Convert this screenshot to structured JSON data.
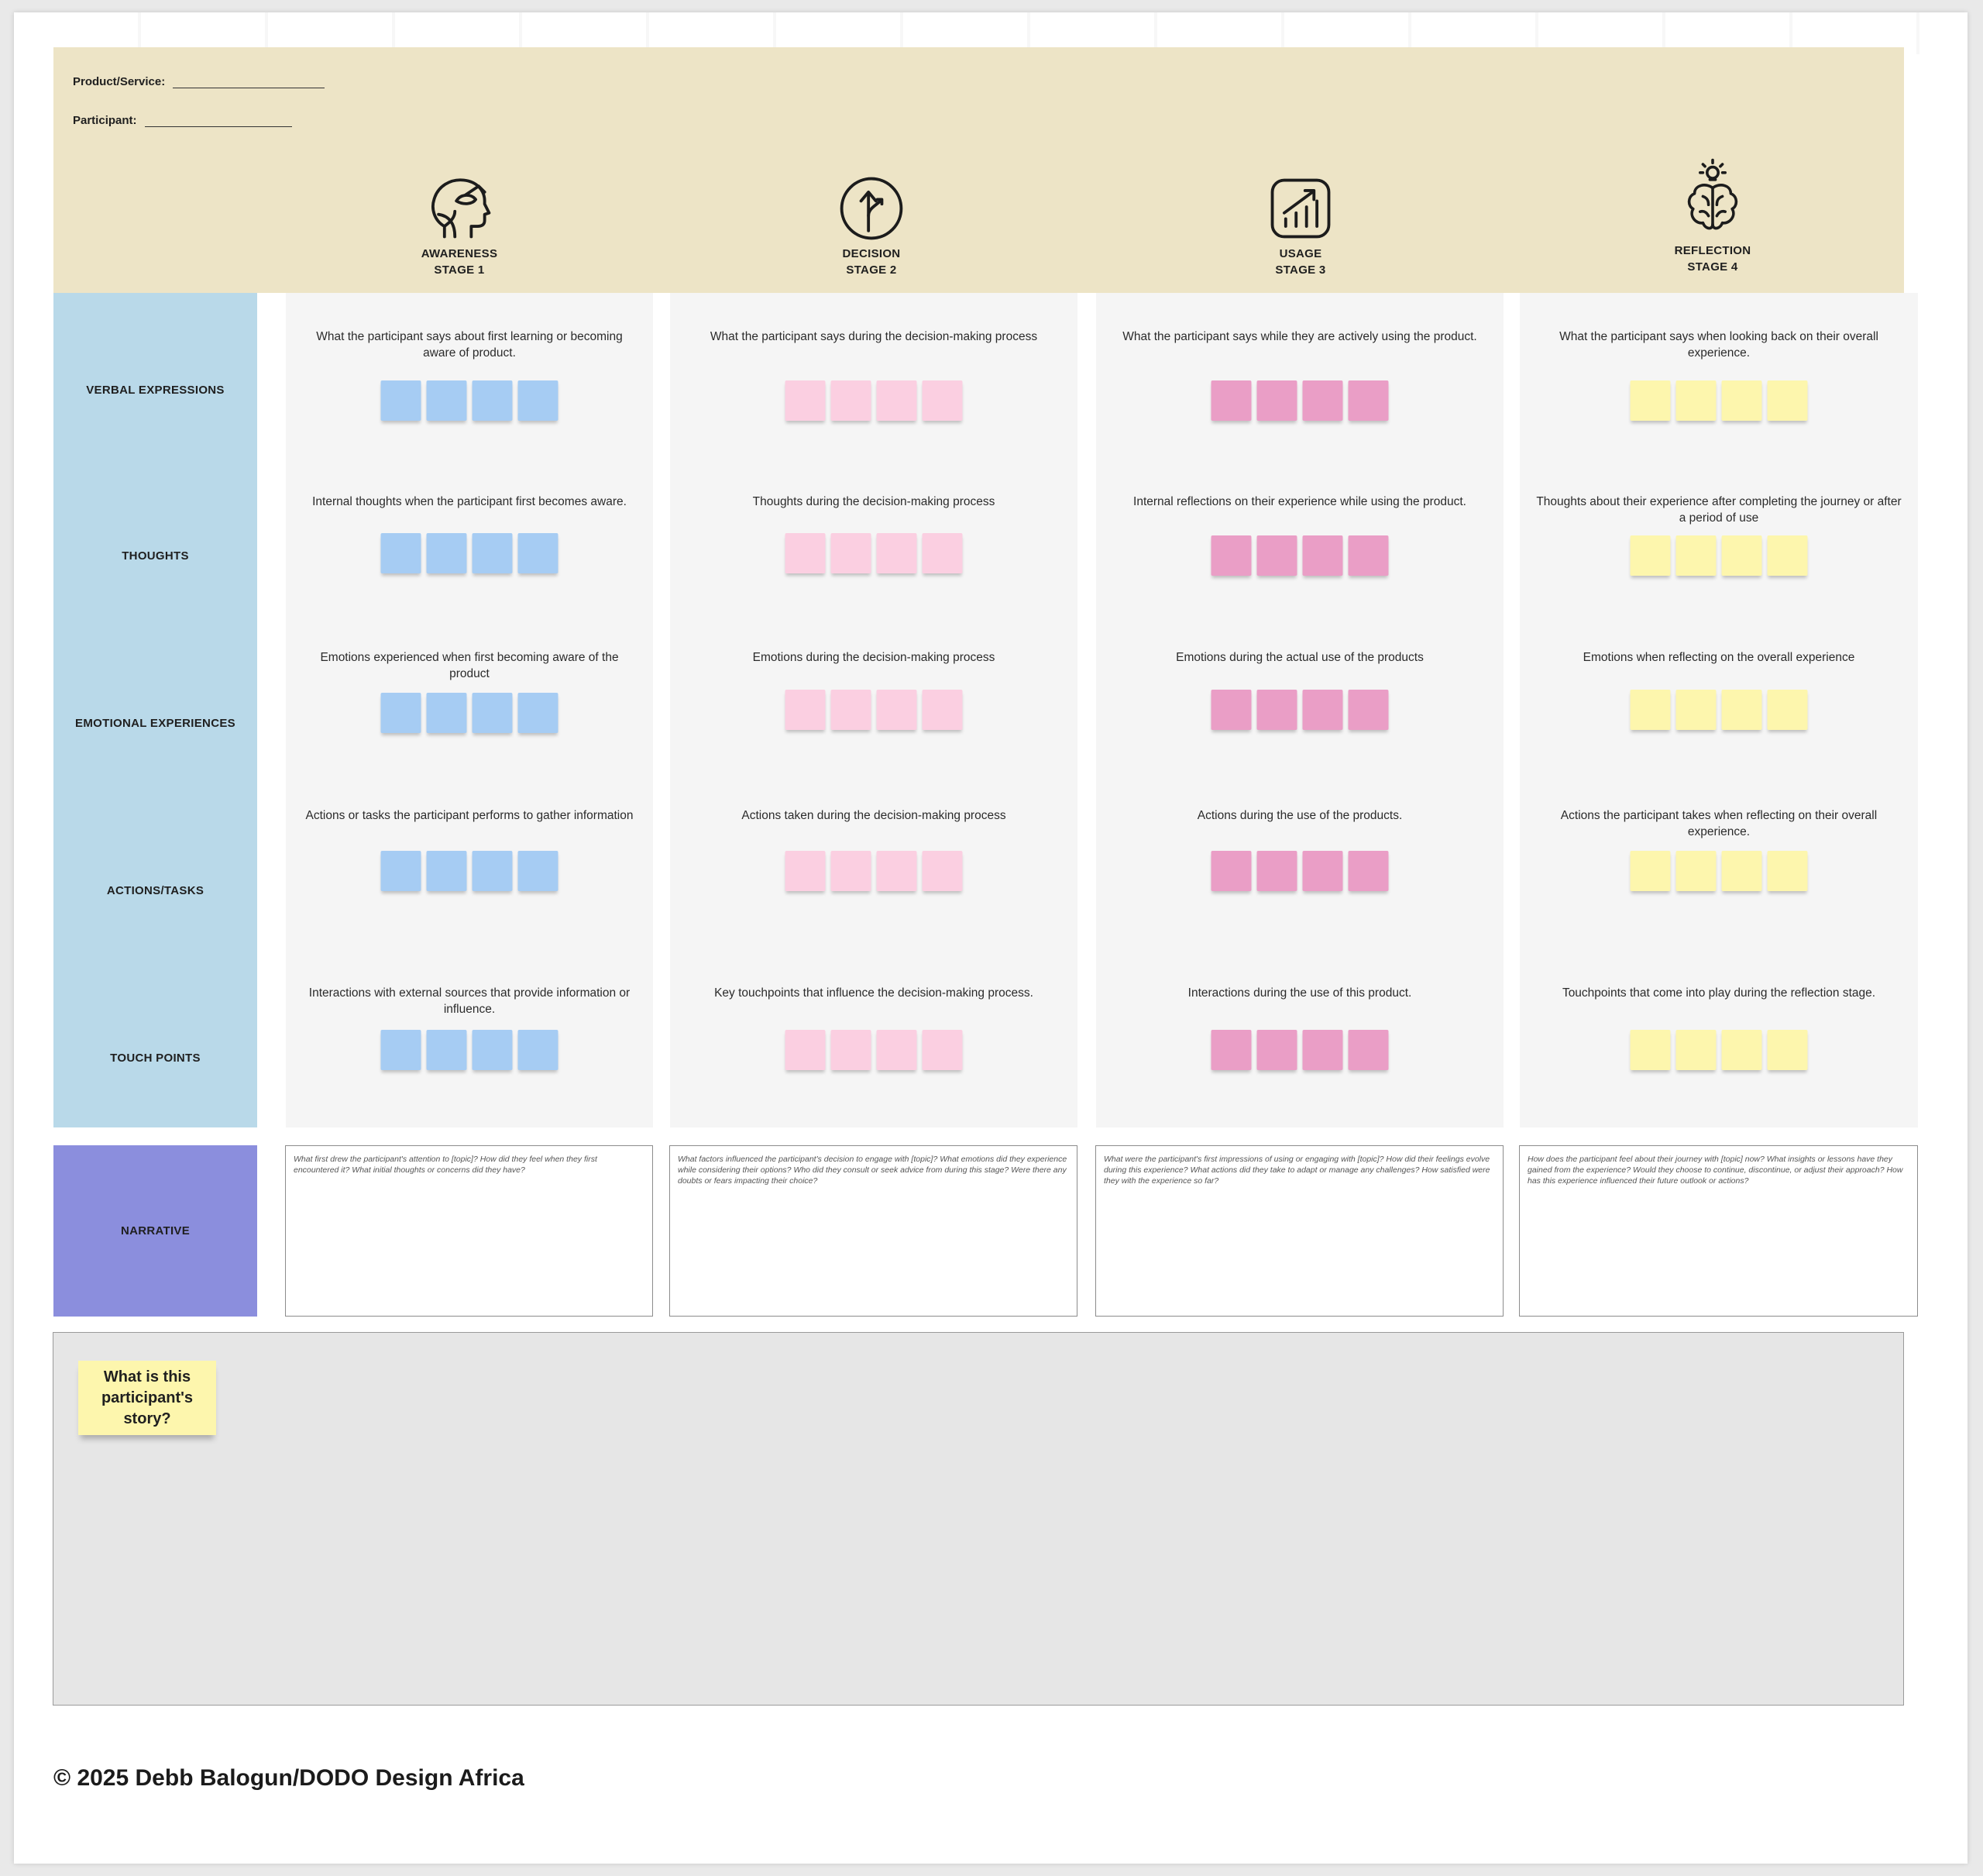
{
  "header": {
    "product_label": "Product/Service:",
    "participant_label": "Participant:"
  },
  "stages": [
    {
      "name": "AWARENESS",
      "num": "STAGE 1",
      "icon": "head-profile-icon"
    },
    {
      "name": "DECISION",
      "num": "STAGE 2",
      "icon": "direction-arrow-icon"
    },
    {
      "name": "USAGE",
      "num": "STAGE 3",
      "icon": "growth-chart-icon"
    },
    {
      "name": "REFLECTION",
      "num": "STAGE 4",
      "icon": "brain-lightbulb-icon"
    }
  ],
  "rows": [
    "VERBAL EXPRESSIONS",
    "THOUGHTS",
    "EMOTIONAL EXPERIENCES",
    "ACTIONS/TASKS",
    "TOUCH POINTS"
  ],
  "cells": [
    [
      "What the participant says about first learning or becoming aware of product.",
      "Internal thoughts when the participant first becomes aware.",
      "Emotions experienced when first becoming aware of the product",
      "Actions or tasks the participant performs to gather information",
      "Interactions with external sources that provide information or influence."
    ],
    [
      "What the participant says during the decision-making process",
      "Thoughts during the decision-making process",
      "Emotions during the decision-making process",
      "Actions taken during the decision-making process",
      "Key touchpoints that influence the decision-making process."
    ],
    [
      "What the participant says while they are actively using the product.",
      "Internal reflections on their experience while using the product.",
      "Emotions during the actual use of the products",
      "Actions during the use of the products.",
      "Interactions during the use of this product."
    ],
    [
      "What the participant says when looking back on their overall experience.",
      "Thoughts about their experience after completing the journey or after a period of use",
      "Emotions when reflecting on the overall experience",
      "Actions the participant takes when reflecting on their overall experience.",
      "Touchpoints that come into play during the reflection stage."
    ]
  ],
  "note_colors": {
    "blue": "#a6ccf3",
    "pink": "#fbcfe1",
    "magenta": "#ea9ec6",
    "yellow": "#fdf6ad"
  },
  "narrative": {
    "label": "NARRATIVE",
    "prompts": [
      "What first drew the participant's attention to [topic]? How did they feel when they first encountered it? What initial thoughts or concerns did they have?",
      "What factors influenced the participant's decision to engage with [topic]? What emotions did they experience while considering their options? Who did they consult or seek advice from during this stage? Were there any doubts or fears impacting their choice?",
      "What were the participant's first impressions of using or engaging with [topic]? How did their feelings evolve during this experience? What actions did they take to adapt or manage any challenges? How satisfied were they with the experience so far?",
      "How does the participant feel about their journey with [topic] now? What insights or lessons have they gained from the experience? Would they choose to continue, discontinue, or adjust their approach? How has this experience influenced their future outlook or actions?"
    ]
  },
  "story": {
    "note": "What is this participant's story?"
  },
  "footer": {
    "copyright": "© 2025 Debb Balogun/DODO Design Africa"
  }
}
